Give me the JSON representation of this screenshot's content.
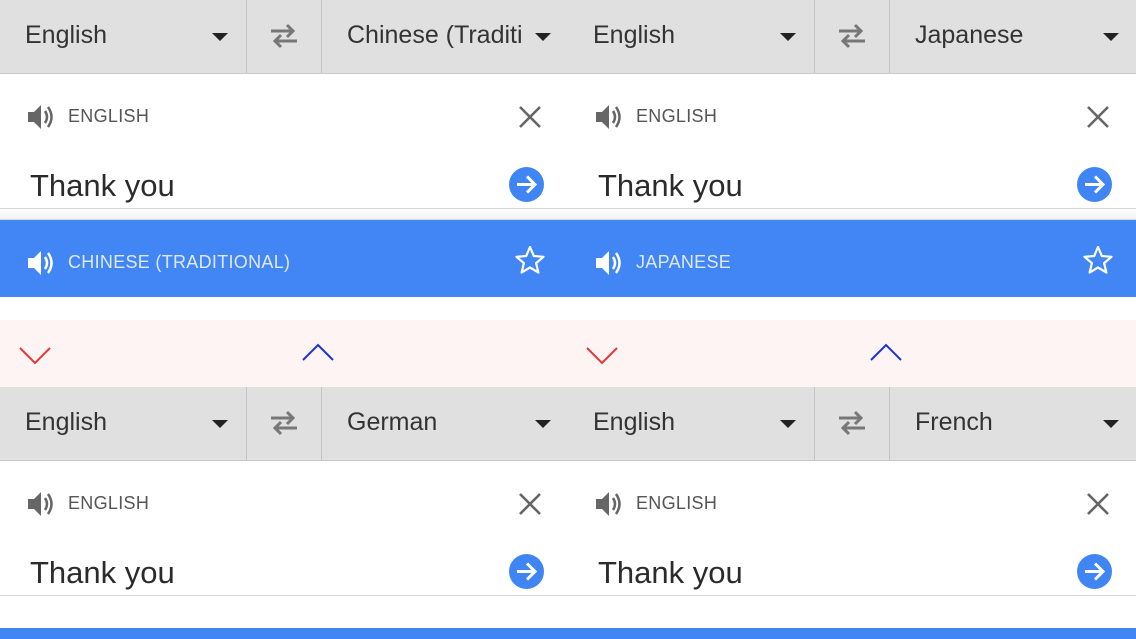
{
  "colors": {
    "accent": "#4285f4",
    "go_button": "#3f86f4",
    "bar_bg": "#e0e0e0",
    "strip_bg": "#fef4f4",
    "chevron_down": "#e53935",
    "chevron_up": "#1a33d6"
  },
  "icons": {
    "swap": "swap-arrows-icon",
    "speaker": "speaker-icon",
    "clear": "close-icon",
    "go": "arrow-right-circle-icon",
    "favorite": "star-outline-icon",
    "expand": "chevron-down-icon",
    "collapse": "chevron-up-icon"
  },
  "panels": {
    "top_left": {
      "source_lang": "English",
      "target_lang": "Chinese (Traditi",
      "source_label": "ENGLISH",
      "input_text": "Thank you",
      "result_label": "CHINESE (TRADITIONAL)"
    },
    "top_right": {
      "source_lang": "English",
      "target_lang": "Japanese",
      "source_label": "ENGLISH",
      "input_text": "Thank you",
      "result_label": "JAPANESE"
    },
    "bottom_left": {
      "source_lang": "English",
      "target_lang": "German",
      "source_label": "ENGLISH",
      "input_text": "Thank you"
    },
    "bottom_right": {
      "source_lang": "English",
      "target_lang": "French",
      "source_label": "ENGLISH",
      "input_text": "Thank you"
    }
  }
}
